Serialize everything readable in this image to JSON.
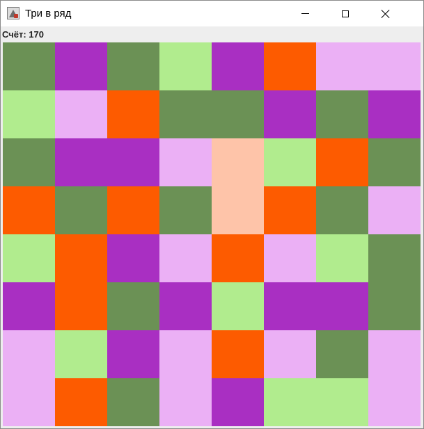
{
  "window": {
    "title": "Три в ряд"
  },
  "score": {
    "text": "Счёт: 170"
  },
  "colors": {
    "G": "#6b9155",
    "P": "#a92fc2",
    "L": "#b1ec8e",
    "O": "#fd5b00",
    "K": "#ebb0f5",
    "S": "#fec4a9"
  },
  "board": [
    [
      "G",
      "P",
      "G",
      "L",
      "P",
      "O",
      "K",
      "K"
    ],
    [
      "L",
      "K",
      "O",
      "G",
      "G",
      "P",
      "G",
      "P"
    ],
    [
      "G",
      "P",
      "P",
      "K",
      "S",
      "L",
      "O",
      "G"
    ],
    [
      "O",
      "G",
      "O",
      "G",
      "S",
      "O",
      "G",
      "K"
    ],
    [
      "L",
      "O",
      "P",
      "K",
      "O",
      "K",
      "L",
      "G"
    ],
    [
      "P",
      "O",
      "G",
      "P",
      "L",
      "P",
      "P",
      "G"
    ],
    [
      "K",
      "L",
      "P",
      "K",
      "O",
      "K",
      "G",
      "K"
    ],
    [
      "K",
      "O",
      "G",
      "K",
      "P",
      "L",
      "L",
      "K"
    ]
  ]
}
